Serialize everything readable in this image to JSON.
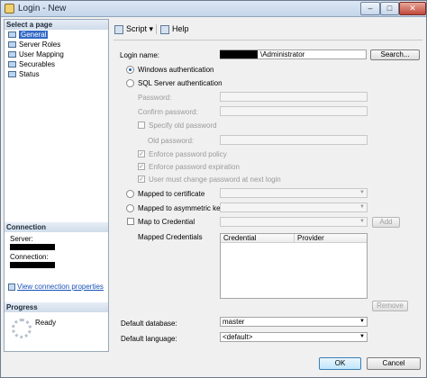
{
  "window": {
    "title": "Login - New"
  },
  "left_pane": {
    "select_page_header": "Select a page",
    "pages": [
      {
        "label": "General",
        "selected": true
      },
      {
        "label": "Server Roles",
        "selected": false
      },
      {
        "label": "User Mapping",
        "selected": false
      },
      {
        "label": "Securables",
        "selected": false
      },
      {
        "label": "Status",
        "selected": false
      }
    ],
    "connection_header": "Connection",
    "server_label": "Server:",
    "connection_label": "Connection:",
    "view_link": "View connection properties",
    "progress_header": "Progress",
    "progress_status": "Ready"
  },
  "toolbar": {
    "script_label": "Script",
    "help_label": "Help"
  },
  "form": {
    "login_name_label": "Login name:",
    "login_name_value": "\\Administrator",
    "search_button": "Search...",
    "windows_auth": "Windows authentication",
    "sql_auth": "SQL Server authentication",
    "password_label": "Password:",
    "confirm_password_label": "Confirm password:",
    "specify_old_password": "Specify old password",
    "old_password_label": "Old password:",
    "enforce_policy": "Enforce password policy",
    "enforce_expiration": "Enforce password expiration",
    "must_change": "User must change password at next login",
    "mapped_cert": "Mapped to certificate",
    "mapped_asym": "Mapped to asymmetric key",
    "map_credential": "Map to Credential",
    "add_button": "Add",
    "mapped_credentials_label": "Mapped Credentials",
    "grid_columns": [
      "Credential",
      "Provider"
    ],
    "remove_button": "Remove",
    "default_database_label": "Default database:",
    "default_database_value": "master",
    "default_language_label": "Default language:",
    "default_language_value": "<default>"
  },
  "footer": {
    "ok_button": "OK",
    "cancel_button": "Cancel"
  },
  "colors": {
    "selected_page": "#3168c6",
    "link": "#1a52b8"
  }
}
